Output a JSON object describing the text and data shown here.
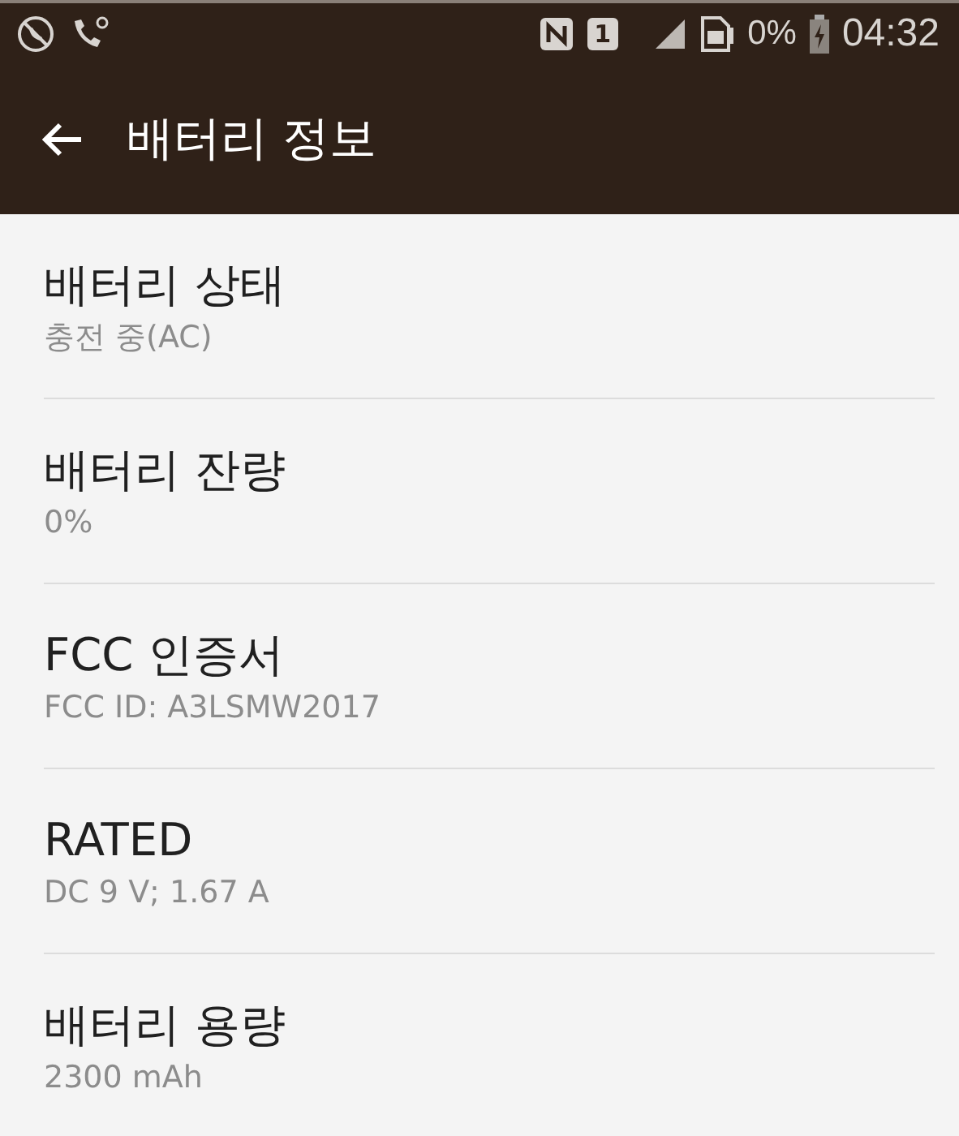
{
  "status_bar": {
    "sim_slot": "1",
    "battery_percent": "0%",
    "time": "04:32"
  },
  "app_bar": {
    "title": "배터리 정보"
  },
  "items": [
    {
      "title": "배터리 상태",
      "summary": "충전 중(AC)"
    },
    {
      "title": "배터리 잔량",
      "summary": "0%"
    },
    {
      "title": "FCC 인증서",
      "summary": "FCC ID: A3LSMW2017"
    },
    {
      "title": "RATED",
      "summary": "DC 9 V; 1.67 A"
    },
    {
      "title": "배터리 용량",
      "summary": "2300 mAh"
    }
  ]
}
